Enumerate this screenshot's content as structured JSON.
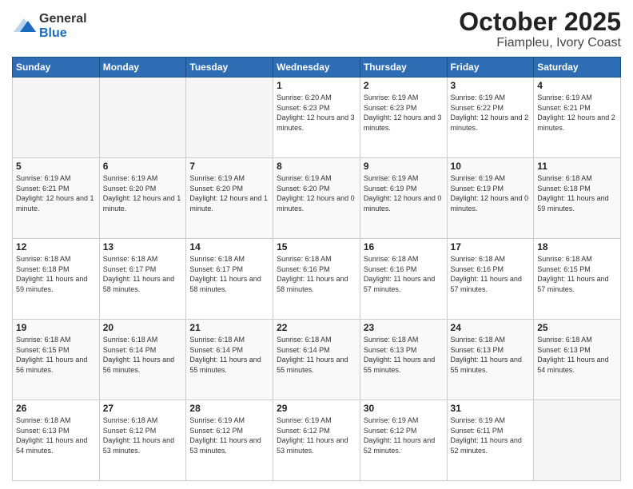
{
  "header": {
    "logo_general": "General",
    "logo_blue": "Blue",
    "title": "October 2025",
    "subtitle": "Fiampleu, Ivory Coast"
  },
  "weekdays": [
    "Sunday",
    "Monday",
    "Tuesday",
    "Wednesday",
    "Thursday",
    "Friday",
    "Saturday"
  ],
  "weeks": [
    [
      {
        "day": "",
        "info": ""
      },
      {
        "day": "",
        "info": ""
      },
      {
        "day": "",
        "info": ""
      },
      {
        "day": "1",
        "info": "Sunrise: 6:20 AM\nSunset: 6:23 PM\nDaylight: 12 hours and 3 minutes."
      },
      {
        "day": "2",
        "info": "Sunrise: 6:19 AM\nSunset: 6:23 PM\nDaylight: 12 hours and 3 minutes."
      },
      {
        "day": "3",
        "info": "Sunrise: 6:19 AM\nSunset: 6:22 PM\nDaylight: 12 hours and 2 minutes."
      },
      {
        "day": "4",
        "info": "Sunrise: 6:19 AM\nSunset: 6:21 PM\nDaylight: 12 hours and 2 minutes."
      }
    ],
    [
      {
        "day": "5",
        "info": "Sunrise: 6:19 AM\nSunset: 6:21 PM\nDaylight: 12 hours and 1 minute."
      },
      {
        "day": "6",
        "info": "Sunrise: 6:19 AM\nSunset: 6:20 PM\nDaylight: 12 hours and 1 minute."
      },
      {
        "day": "7",
        "info": "Sunrise: 6:19 AM\nSunset: 6:20 PM\nDaylight: 12 hours and 1 minute."
      },
      {
        "day": "8",
        "info": "Sunrise: 6:19 AM\nSunset: 6:20 PM\nDaylight: 12 hours and 0 minutes."
      },
      {
        "day": "9",
        "info": "Sunrise: 6:19 AM\nSunset: 6:19 PM\nDaylight: 12 hours and 0 minutes."
      },
      {
        "day": "10",
        "info": "Sunrise: 6:19 AM\nSunset: 6:19 PM\nDaylight: 12 hours and 0 minutes."
      },
      {
        "day": "11",
        "info": "Sunrise: 6:18 AM\nSunset: 6:18 PM\nDaylight: 11 hours and 59 minutes."
      }
    ],
    [
      {
        "day": "12",
        "info": "Sunrise: 6:18 AM\nSunset: 6:18 PM\nDaylight: 11 hours and 59 minutes."
      },
      {
        "day": "13",
        "info": "Sunrise: 6:18 AM\nSunset: 6:17 PM\nDaylight: 11 hours and 58 minutes."
      },
      {
        "day": "14",
        "info": "Sunrise: 6:18 AM\nSunset: 6:17 PM\nDaylight: 11 hours and 58 minutes."
      },
      {
        "day": "15",
        "info": "Sunrise: 6:18 AM\nSunset: 6:16 PM\nDaylight: 11 hours and 58 minutes."
      },
      {
        "day": "16",
        "info": "Sunrise: 6:18 AM\nSunset: 6:16 PM\nDaylight: 11 hours and 57 minutes."
      },
      {
        "day": "17",
        "info": "Sunrise: 6:18 AM\nSunset: 6:16 PM\nDaylight: 11 hours and 57 minutes."
      },
      {
        "day": "18",
        "info": "Sunrise: 6:18 AM\nSunset: 6:15 PM\nDaylight: 11 hours and 57 minutes."
      }
    ],
    [
      {
        "day": "19",
        "info": "Sunrise: 6:18 AM\nSunset: 6:15 PM\nDaylight: 11 hours and 56 minutes."
      },
      {
        "day": "20",
        "info": "Sunrise: 6:18 AM\nSunset: 6:14 PM\nDaylight: 11 hours and 56 minutes."
      },
      {
        "day": "21",
        "info": "Sunrise: 6:18 AM\nSunset: 6:14 PM\nDaylight: 11 hours and 55 minutes."
      },
      {
        "day": "22",
        "info": "Sunrise: 6:18 AM\nSunset: 6:14 PM\nDaylight: 11 hours and 55 minutes."
      },
      {
        "day": "23",
        "info": "Sunrise: 6:18 AM\nSunset: 6:13 PM\nDaylight: 11 hours and 55 minutes."
      },
      {
        "day": "24",
        "info": "Sunrise: 6:18 AM\nSunset: 6:13 PM\nDaylight: 11 hours and 55 minutes."
      },
      {
        "day": "25",
        "info": "Sunrise: 6:18 AM\nSunset: 6:13 PM\nDaylight: 11 hours and 54 minutes."
      }
    ],
    [
      {
        "day": "26",
        "info": "Sunrise: 6:18 AM\nSunset: 6:13 PM\nDaylight: 11 hours and 54 minutes."
      },
      {
        "day": "27",
        "info": "Sunrise: 6:18 AM\nSunset: 6:12 PM\nDaylight: 11 hours and 53 minutes."
      },
      {
        "day": "28",
        "info": "Sunrise: 6:19 AM\nSunset: 6:12 PM\nDaylight: 11 hours and 53 minutes."
      },
      {
        "day": "29",
        "info": "Sunrise: 6:19 AM\nSunset: 6:12 PM\nDaylight: 11 hours and 53 minutes."
      },
      {
        "day": "30",
        "info": "Sunrise: 6:19 AM\nSunset: 6:12 PM\nDaylight: 11 hours and 52 minutes."
      },
      {
        "day": "31",
        "info": "Sunrise: 6:19 AM\nSunset: 6:11 PM\nDaylight: 11 hours and 52 minutes."
      },
      {
        "day": "",
        "info": ""
      }
    ]
  ]
}
